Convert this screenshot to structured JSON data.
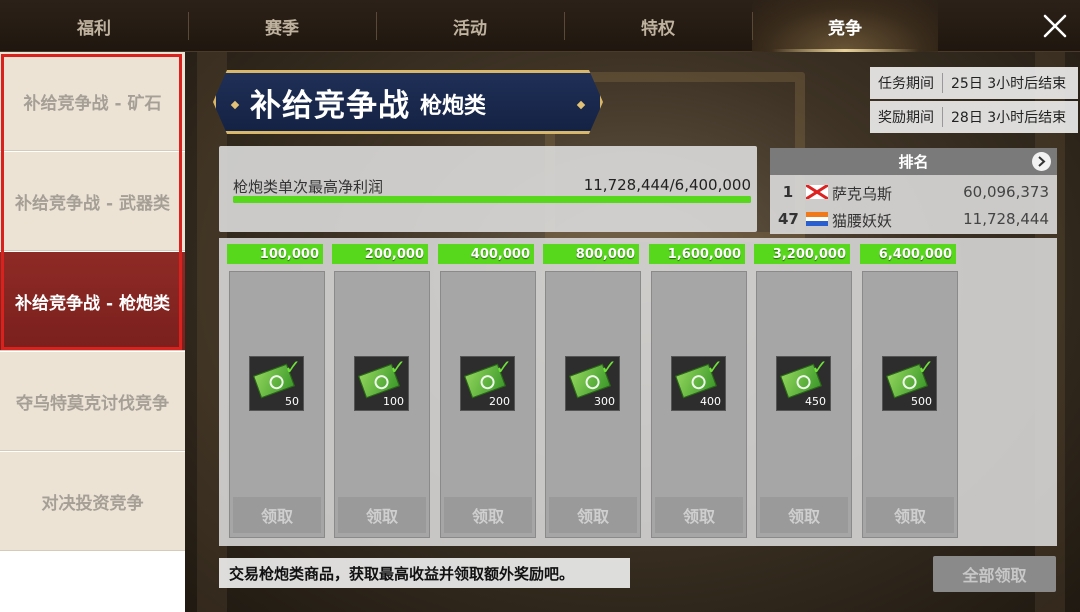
{
  "tabs": [
    {
      "label": "福利",
      "active": false
    },
    {
      "label": "赛季",
      "active": false
    },
    {
      "label": "活动",
      "active": false
    },
    {
      "label": "特权",
      "active": false
    },
    {
      "label": "竞争",
      "active": true
    }
  ],
  "side_menu": [
    {
      "label": "补给竞争战 - 矿石",
      "active": false
    },
    {
      "label": "补给竞争战 - 武器类",
      "active": false
    },
    {
      "label": "补给竞争战 - 枪炮类",
      "active": true
    },
    {
      "label": "夺乌特莫克讨伐竞争",
      "active": false
    },
    {
      "label": "对决投资竞争",
      "active": false
    }
  ],
  "banner": {
    "title": "补给竞争战",
    "subtitle": "枪炮类"
  },
  "periods": {
    "mission": {
      "label": "任务期间",
      "value": "25日 3小时后结束"
    },
    "reward": {
      "label": "奖励期间",
      "value": "28日 3小时后结束"
    }
  },
  "progress": {
    "label": "枪炮类单次最高净利润",
    "value_text": "11,728,444/6,400,000",
    "fill_fraction": 1.0
  },
  "ranking": {
    "header": "排名",
    "rows": [
      {
        "rank": "1",
        "name": "萨克乌斯",
        "score": "60,096,373",
        "flag": "red-cross-flag"
      },
      {
        "rank": "47",
        "name": "猫腰妖妖",
        "score": "11,728,444",
        "flag": "orange-white-blue-flag"
      }
    ]
  },
  "rewards": [
    {
      "threshold": "100,000",
      "quantity": "50",
      "claim_label": "领取"
    },
    {
      "threshold": "200,000",
      "quantity": "100",
      "claim_label": "领取"
    },
    {
      "threshold": "400,000",
      "quantity": "200",
      "claim_label": "领取"
    },
    {
      "threshold": "800,000",
      "quantity": "300",
      "claim_label": "领取"
    },
    {
      "threshold": "1,600,000",
      "quantity": "400",
      "claim_label": "领取"
    },
    {
      "threshold": "3,200,000",
      "quantity": "450",
      "claim_label": "领取"
    },
    {
      "threshold": "6,400,000",
      "quantity": "500",
      "claim_label": "领取"
    }
  ],
  "reward_icon": "cash-ticket-icon",
  "tip": "交易枪炮类商品，获取最高收益并领取额外奖励吧。",
  "claim_all_label": "全部领取",
  "colors": {
    "accent_green": "#57d81d",
    "active_red": "#8e2a26",
    "highlight_frame": "#d9211e"
  }
}
